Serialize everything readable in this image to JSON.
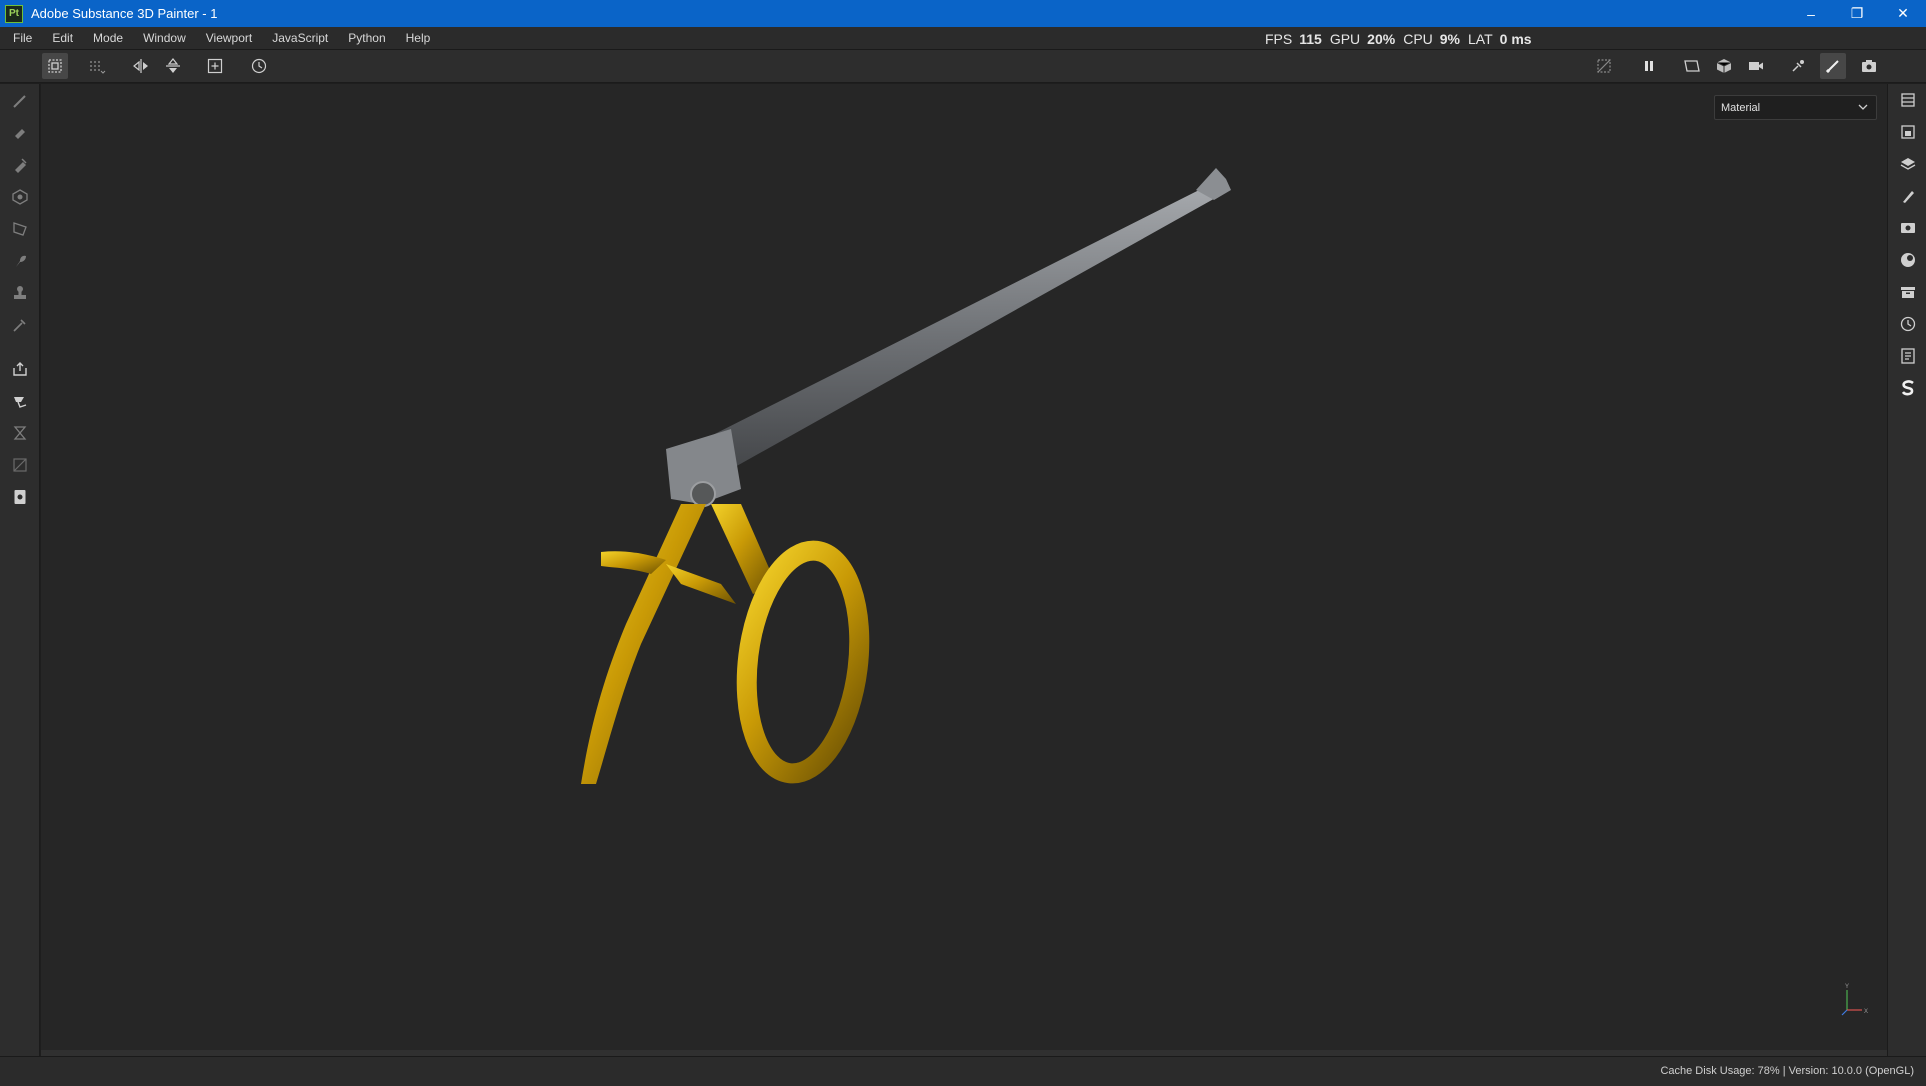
{
  "window": {
    "app_logo": "Pt",
    "title": "Adobe Substance 3D Painter - 1",
    "controls": {
      "minimize": "–",
      "maximize": "❐",
      "close": "✕"
    }
  },
  "menu": {
    "items": [
      "File",
      "Edit",
      "Mode",
      "Window",
      "Viewport",
      "JavaScript",
      "Python",
      "Help"
    ]
  },
  "stats": {
    "fps_label": "FPS",
    "fps_value": "115",
    "gpu_label": "GPU",
    "gpu_value": "20%",
    "cpu_label": "CPU",
    "cpu_value": "9%",
    "lat_label": "LAT",
    "lat_value": "0 ms"
  },
  "viewport": {
    "display_mode": "Material",
    "model_colors": {
      "metal": "#7a7d82",
      "gold": "#d4a90a"
    },
    "gizmo": {
      "y": "Y",
      "x": "X"
    }
  },
  "status": {
    "text": "Cache Disk Usage:   78% | Version: 10.0.0 (OpenGL)"
  },
  "icons": {
    "toolbar_left": [
      "selection-icon",
      "grid-select-icon",
      "mirror-x-icon",
      "mirror-y-icon",
      "add-frame-icon",
      "history-icon"
    ],
    "toolbar_right": [
      "hide-icon",
      "pause-icon",
      "uv-view-icon",
      "cube-view-icon",
      "camera-icon",
      "brush-settings-icon",
      "paint-icon",
      "screenshot-icon"
    ],
    "left_tools": [
      "paint-brush-icon",
      "eraser-icon",
      "projection-icon",
      "geometry-fill-icon",
      "polygon-fill-icon",
      "smudge-icon",
      "clone-stamp-icon",
      "color-picker-icon",
      "export-icon",
      "bake-icon",
      "hourglass-icon",
      "disabled-tool-icon",
      "document-icon"
    ],
    "right_dock": [
      "layers-stack-icon",
      "texture-set-icon",
      "layers-icon",
      "properties-icon",
      "display-settings-icon",
      "environment-icon",
      "shelf-icon",
      "history-icon",
      "log-icon",
      "substance-icon"
    ]
  }
}
